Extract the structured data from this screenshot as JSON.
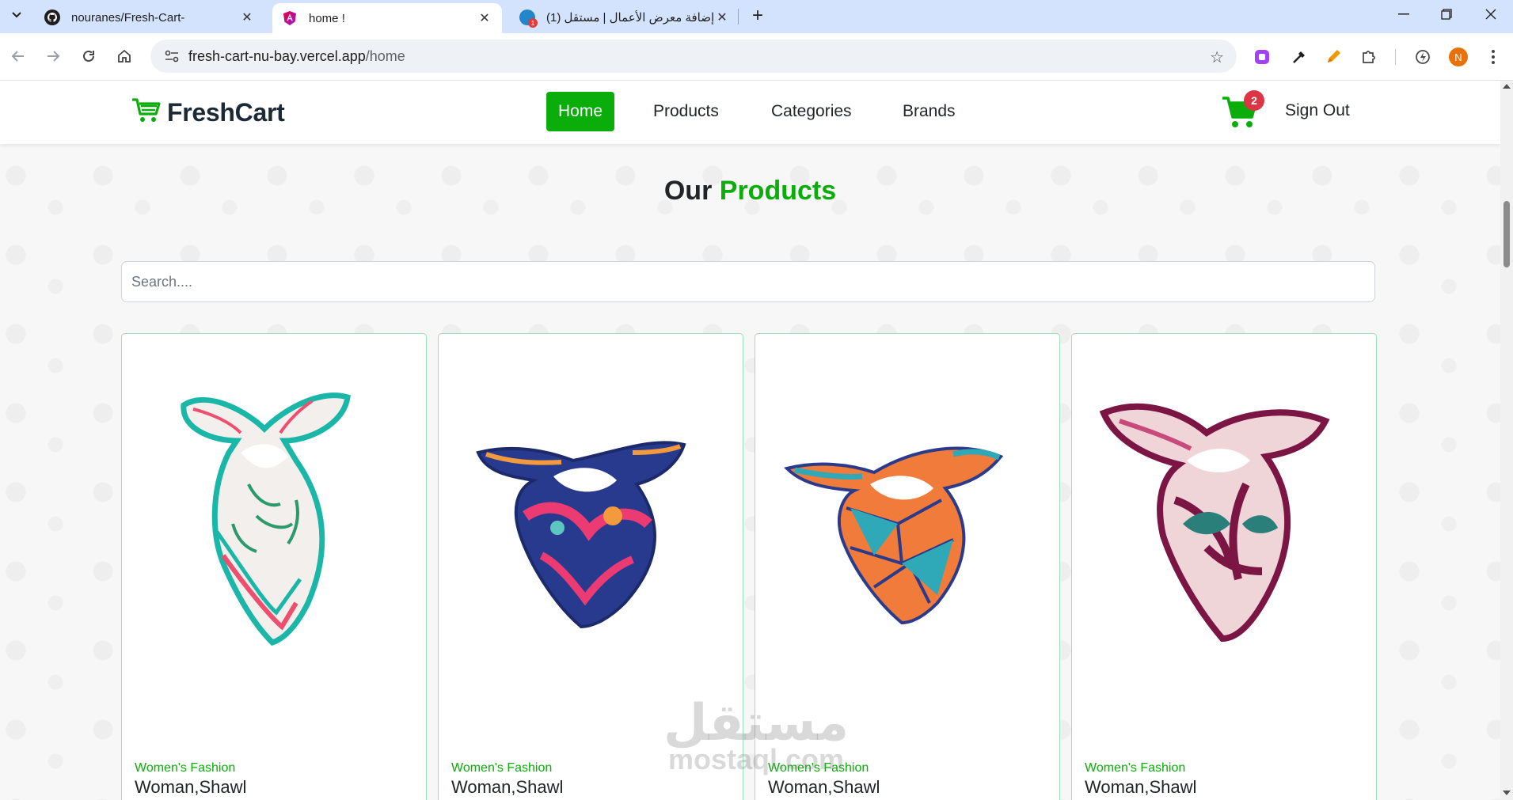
{
  "browser": {
    "tabs": [
      {
        "title": "nouranes/Fresh-Cart-",
        "favicon": "github-icon",
        "active": false
      },
      {
        "title": "home !",
        "favicon": "angular-icon",
        "active": true
      },
      {
        "title": "(1) إضافة معرض الأعمال | مستقل",
        "favicon": "mostaql-icon",
        "active": false
      }
    ],
    "url_host": "fresh-cart-nu-bay.vercel.app",
    "url_path": "/home",
    "profile_initial": "N"
  },
  "navbar": {
    "brand": "FreshCart",
    "links": [
      {
        "label": "Home",
        "active": true
      },
      {
        "label": "Products",
        "active": false
      },
      {
        "label": "Categories",
        "active": false
      },
      {
        "label": "Brands",
        "active": false
      }
    ],
    "cart_count": "2",
    "sign_out": "Sign Out"
  },
  "main": {
    "title_prefix": "Our",
    "title_accent": "Products",
    "search_placeholder": "Search...."
  },
  "products": [
    {
      "category": "Women's Fashion",
      "name": "Woman,Shawl",
      "scarf": "teal-floral"
    },
    {
      "category": "Women's Fashion",
      "name": "Woman,Shawl",
      "scarf": "navy-pink"
    },
    {
      "category": "Women's Fashion",
      "name": "Woman,Shawl",
      "scarf": "geometric-orange"
    },
    {
      "category": "Women's Fashion",
      "name": "Woman,Shawl",
      "scarf": "burgundy-leaf"
    }
  ],
  "watermark": {
    "arabic": "مستقل",
    "latin": "mostaql.com"
  },
  "colors": {
    "accent": "#0aad0a",
    "badge": "#dc3545",
    "card_border": "#9be0b8",
    "tabbar": "#d3e3fd"
  }
}
